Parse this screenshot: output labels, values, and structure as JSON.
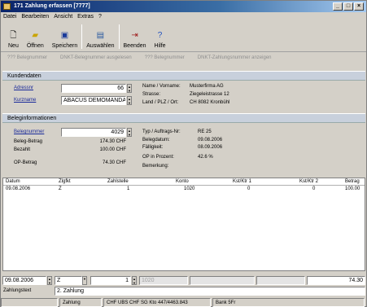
{
  "window": {
    "title": "171 Zahlung erfassen [7777]",
    "controls": [
      "_",
      "□",
      "×"
    ]
  },
  "menu": [
    "Datei",
    "Bearbeiten",
    "Ansicht",
    "Extras",
    "?"
  ],
  "toolbar": {
    "new": "Neu",
    "open": "Öffnen",
    "save": "Speichern",
    "select": "Auswählen",
    "exit": "Beenden",
    "help": "Hilfe"
  },
  "subtabs": [
    "??? Belegnummer",
    "DNKT-Belegnummer ausgelesen",
    "??? Belegnummer",
    "DNKT-Zahlungsnummer anzeigen"
  ],
  "customer": {
    "header": "Kundendaten",
    "address_label": "Adressnr",
    "address_value": "66",
    "shortname_label": "Kurzname",
    "shortname_value": "ABACUS DEMOMANDANT",
    "name_label": "Name / Vorname:",
    "name_value": "Musterfirma AG",
    "street_label": "Strasse:",
    "street_value": "Ziegeleistrasse 12",
    "place_label": "Land / PLZ / Ort:",
    "place_value": "CH 8082 Kronbühl"
  },
  "document": {
    "header": "Beleginformationen",
    "docnr_label": "Belegnummer",
    "docnr_value": "4029",
    "amount_label": "Beleg-Betrag",
    "amount_value": "174.30 CHF",
    "paid_label": "Bezahlt",
    "paid_value": "100.00 CHF",
    "op_label": "OP-Betrag",
    "op_value": "74.30 CHF",
    "type_label": "Typ / Auftrags-Nr:",
    "type_value": "RE 25",
    "date_label": "Belegdatum:",
    "date_value": "09.08.2006",
    "due_label": "Fälligkeit:",
    "due_value": "08.09.2006",
    "percent_label": "OP in Prozent:",
    "percent_value": "42.6 %",
    "remark_label": "Bemerkung:"
  },
  "grid": {
    "columns": [
      "Datum",
      "Zlgfkt",
      "Zahlstelle",
      "Konto",
      "Kst/Ktr 1",
      "Kst/Ktr 2",
      "Betrag"
    ],
    "rows": [
      [
        "09.08.2006",
        "Z",
        "1",
        "1020",
        "0",
        "0",
        "100.00"
      ]
    ]
  },
  "entry": {
    "date": "09.08.2006",
    "type": "Z",
    "office": "1",
    "account": "1020",
    "amount": "74.30",
    "text_label": "Zahlungstext",
    "text_value": "2. Zahlung"
  },
  "statusbar": [
    "",
    "Zahlung",
    "CHF UBS CHF SG Kto 447/4463.843",
    "Bank 5Fr"
  ]
}
